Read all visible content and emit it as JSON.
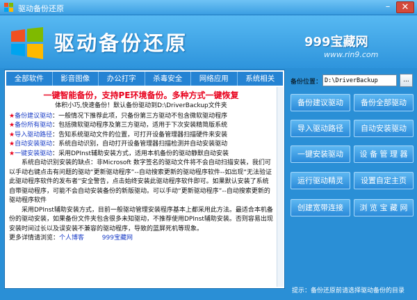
{
  "window": {
    "title": "驱动备份还原",
    "min_symbol": "–",
    "close_symbol": "✕"
  },
  "header": {
    "app_title": "驱动备份还原",
    "brand": "999宝藏网",
    "brand_url": "www.rin9.com"
  },
  "nav": [
    "全部软件",
    "影音图像",
    "办公打字",
    "杀毒安全",
    "网络应用",
    "系统相关"
  ],
  "content": {
    "headline": "一键智能备份，支持PE环境备份。多种方式一键恢复",
    "subline": "体积小巧,快速备份！默认备份驱动到D:\\DriverBackup文件夹",
    "features": [
      {
        "star": "★",
        "name": "备份建议驱动",
        "desc": "：一般情况下推荐此项，只备份第三方驱动不包含微软驱动程序"
      },
      {
        "star": "★",
        "name": "备份所有驱动",
        "desc": "：包括微软驱动程序及第三方驱动，适用于下次安装精简版系统"
      },
      {
        "star": "★",
        "name": "导入驱动路径",
        "desc": "：告知系统驱动文件的位置，可打开设备管理器扫描硬件来安装"
      },
      {
        "star": "★",
        "name": "自动安装驱动",
        "desc": "：系统自动识别，自动打开设备管理器扫描检测并自动安装驱动"
      },
      {
        "star": "★",
        "name": "一键安装驱动",
        "desc": "：采用DPInst辅助安装方式，适用本机备份的驱动静默自动安装"
      }
    ],
    "para1": "系统自动识别安装的缺点：非Microsoft 数字签名的驱动文件将不会自动扫描安装，我们可以手动右键点击有问题的驱动“更新驱动程序”--自动搜索更新的驱动程序软件--如出现“无法验证此驱动程序软件的发布者”安全警告，点击始终安装此驱动程序软件即可。如果默认安装了系统自带驱动程序，可能不会自动安装备份的新版驱动。可以手动“更新驱动程序”--自动搜索更新的驱动程序软件",
    "para2": "采用DPInst辅助安装方式，目前一般驱动管理安装程序基本上都采用此方法。最适合本机备份的驱动安装，如果备份文件夹包含很多未知驱动，不推荐使用DPInst辅助安装。否则容易出现安装时间过长以及误安装不兼容的驱动程序，导致的蓝屏死机等现象。",
    "more_label": "更多详情请浏览：",
    "more_link1": "个人博客",
    "more_link2": "999宝藏网"
  },
  "panel": {
    "path_label": "备份位置：",
    "path_value": "D:\\DriverBackup",
    "browse_label": "...",
    "buttons": [
      "备份建议驱动",
      "备份全部驱动",
      "导入驱动路径",
      "自动安装驱动",
      "一键安装驱动",
      "设 备 管 理 器",
      "运行驱动精灵",
      "设置自定主页",
      "创建宽带连接",
      "浏 览 宝 藏 网"
    ],
    "hint": "提示：备份还原前请选择驱动备份的目录"
  },
  "colors": {
    "accent_blue": "#2a8fd6",
    "highlight_red": "#e8001c",
    "link_blue": "#1c3fc7"
  }
}
